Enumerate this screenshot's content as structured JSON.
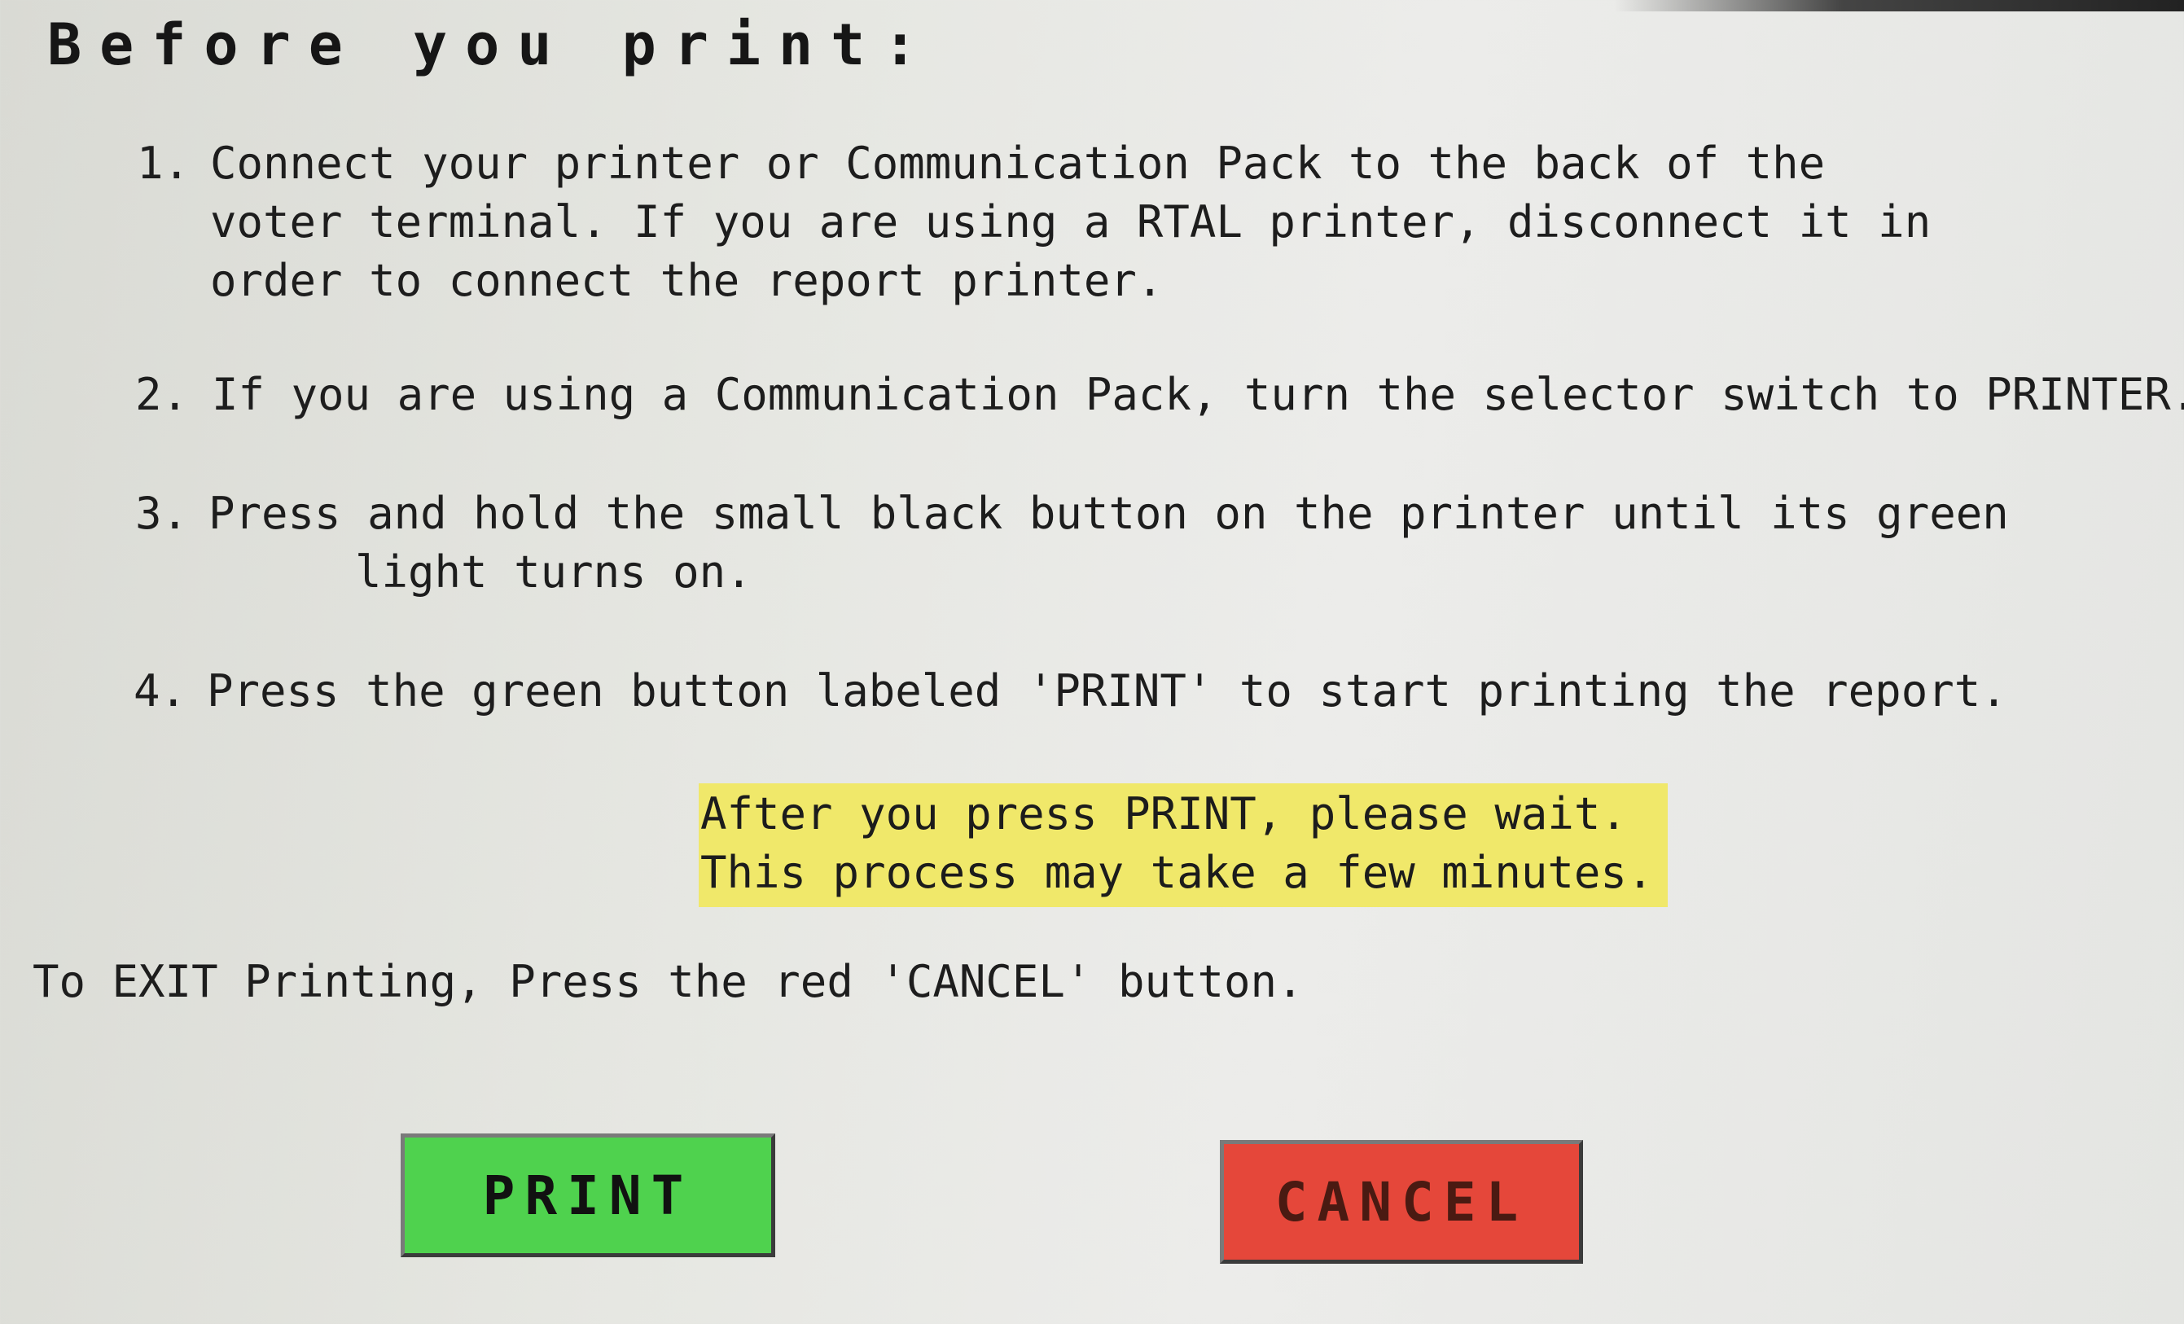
{
  "header": {
    "title": "Before you print:"
  },
  "steps": [
    {
      "number": "1.",
      "lines": [
        "Connect your printer or Communication Pack to the back of the",
        "voter terminal. If you are using a RTAL printer, disconnect it in",
        "order to connect the report printer."
      ]
    },
    {
      "number": "2.",
      "lines": [
        "If you are using a Communication Pack, turn the selector switch to PRINTER."
      ]
    },
    {
      "number": "3.",
      "lines": [
        "Press and hold the small black button on the printer until its green",
        "light turns on."
      ]
    },
    {
      "number": "4.",
      "lines": [
        "Press the green button labeled 'PRINT' to start printing the report."
      ]
    }
  ],
  "notice": {
    "line1": "After you press PRINT, please wait.",
    "line2": "This process may take a few minutes.",
    "highlight_color": "#f0e86a"
  },
  "exit_instruction": "To EXIT Printing, Press the red 'CANCEL' button.",
  "buttons": {
    "print_label": "PRINT",
    "print_color": "#4fd24e",
    "cancel_label": "CANCEL",
    "cancel_color": "#e5473a"
  }
}
